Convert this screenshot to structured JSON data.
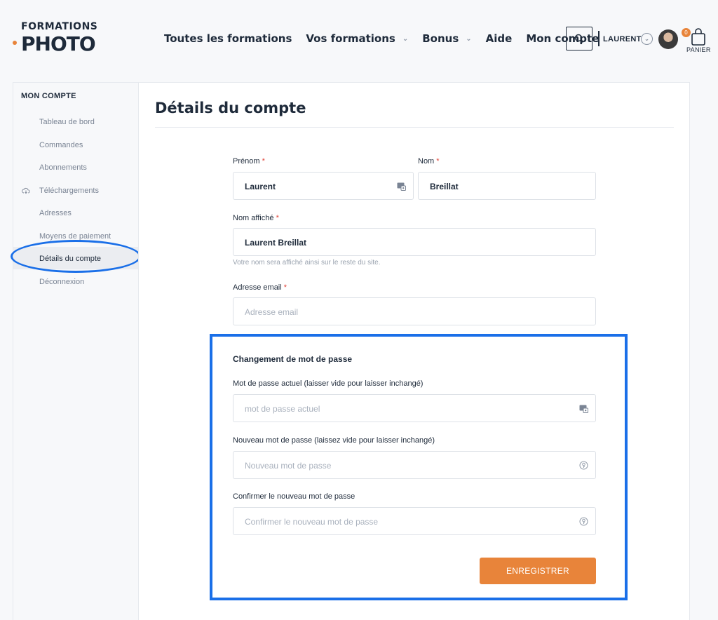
{
  "brand": {
    "top": "FORMATIONS",
    "bottom": "PHOTO",
    "accent": "#e8843a"
  },
  "nav": {
    "items": [
      {
        "label": "Toutes les formations",
        "has_chevron": false
      },
      {
        "label": "Vos formations",
        "has_chevron": true
      },
      {
        "label": "Bonus",
        "has_chevron": true
      },
      {
        "label": "Aide",
        "has_chevron": false
      },
      {
        "label": "Mon compte",
        "has_chevron": false
      }
    ]
  },
  "header": {
    "user_name": "LAURENT",
    "cart_count": "0",
    "cart_label": "PANIER"
  },
  "sidebar": {
    "title": "MON COMPTE",
    "items": [
      {
        "label": "Tableau de bord"
      },
      {
        "label": "Commandes"
      },
      {
        "label": "Abonnements"
      },
      {
        "label": "Téléchargements",
        "icon": "cloud-download-icon"
      },
      {
        "label": "Adresses"
      },
      {
        "label": "Moyens de paiement"
      },
      {
        "label": "Détails du compte",
        "active": true
      },
      {
        "label": "Déconnexion"
      }
    ]
  },
  "form": {
    "page_title": "Détails du compte",
    "first_name": {
      "label": "Prénom",
      "value": "Laurent"
    },
    "last_name": {
      "label": "Nom",
      "value": "Breillat"
    },
    "display_name": {
      "label": "Nom affiché",
      "value": "Laurent Breillat",
      "hint": "Votre nom sera affiché ainsi sur le reste du site."
    },
    "email": {
      "label": "Adresse email",
      "placeholder": "Adresse email"
    },
    "required_mark": "*",
    "password_section": {
      "title": "Changement de mot de passe",
      "current": {
        "label": "Mot de passe actuel (laisser vide pour laisser inchangé)",
        "placeholder": "mot de passe actuel"
      },
      "new": {
        "label": "Nouveau mot de passe (laissez vide pour laisser inchangé)",
        "placeholder": "Nouveau mot de passe"
      },
      "confirm": {
        "label": "Confirmer le nouveau mot de passe",
        "placeholder": "Confirmer le nouveau mot de passe"
      }
    },
    "save_label": "ENREGISTRER"
  },
  "colors": {
    "highlight": "#1a6fe8",
    "button": "#e8843a",
    "required": "#e0463b"
  }
}
